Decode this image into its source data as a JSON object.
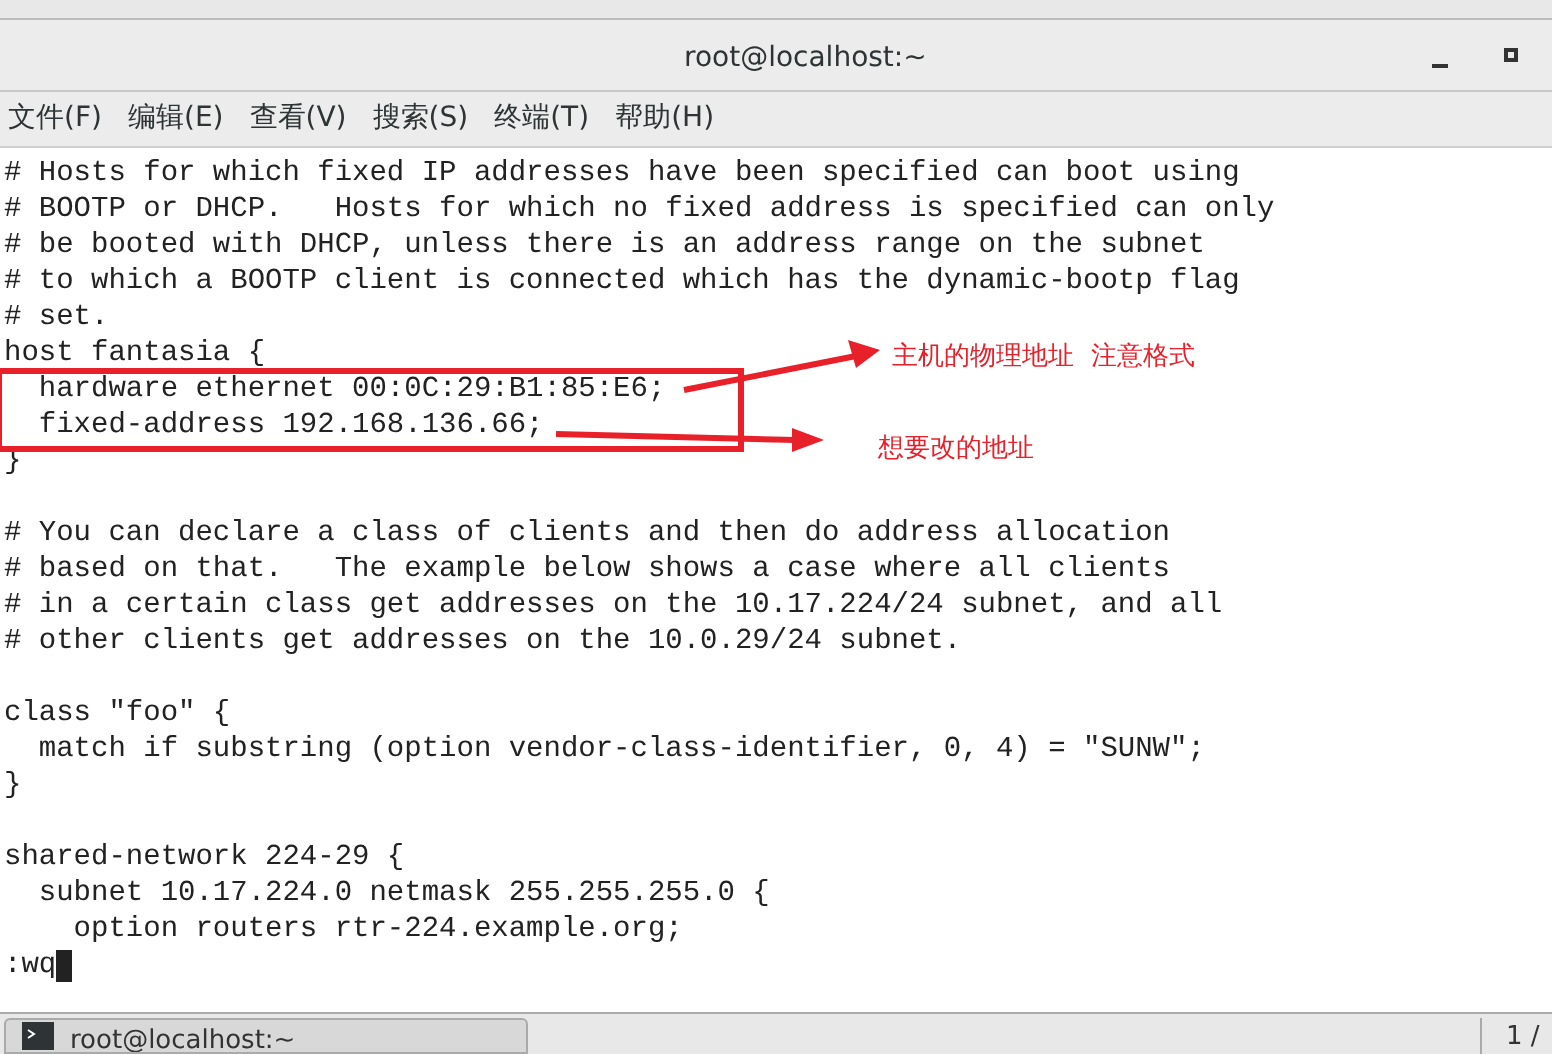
{
  "window": {
    "title": "root@localhost:~"
  },
  "menu": [
    "文件(F)",
    "编辑(E)",
    "查看(V)",
    "搜索(S)",
    "终端(T)",
    "帮助(H)"
  ],
  "terminal_blocks": [
    [
      "# Hosts for which fixed IP addresses have been specified can boot using",
      "# BOOTP or DHCP.   Hosts for which no fixed address is specified can only",
      "# be booted with DHCP, unless there is an address range on the subnet",
      "# to which a BOOTP client is connected which has the dynamic-bootp flag",
      "# set.",
      "host fantasia {",
      "  hardware ethernet 00:0C:29:B1:85:E6;",
      "  fixed-address 192.168.136.66;",
      "}"
    ],
    [
      "# You can declare a class of clients and then do address allocation",
      "# based on that.   The example below shows a case where all clients",
      "# in a certain class get addresses on the 10.17.224/24 subnet, and all",
      "# other clients get addresses on the 10.0.29/24 subnet."
    ],
    [
      "class \"foo\" {",
      "  match if substring (option vendor-class-identifier, 0, 4) = \"SUNW\";",
      "}"
    ],
    [
      "shared-network 224-29 {",
      "  subnet 10.17.224.0 netmask 255.255.255.0 {",
      "    option routers rtr-224.example.org;"
    ]
  ],
  "command": ":wq",
  "annotations": [
    "主机的物理地址  注意格式",
    "想要改的地址"
  ],
  "taskbar": {
    "task": "root@localhost:~",
    "workspace": "1 /"
  }
}
